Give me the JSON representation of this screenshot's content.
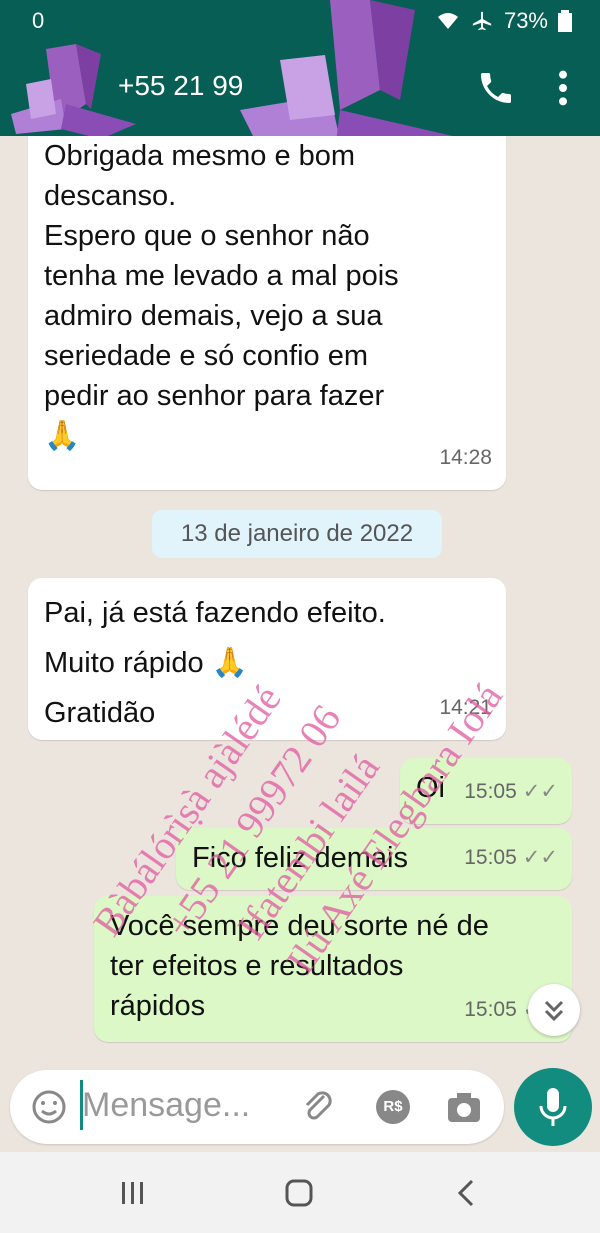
{
  "status_bar": {
    "time": "0",
    "battery": "73%"
  },
  "header": {
    "contact": "+55 21 99"
  },
  "messages": [
    {
      "text": "Obrigada mesmo e bom\ndescanso.\nEspero que o senhor não\ntenha me levado a mal pois\nadmiro demais, vejo a sua\nseriedade e só confio em\npedir ao senhor para fazer\n🙏",
      "time": "14:28"
    },
    {
      "text": "Pai, já está fazendo efeito.\nMuito rápido 🙏\nGratidão",
      "time": "14:21"
    },
    {
      "text": "Oi",
      "time": "15:05"
    },
    {
      "text": "Fico feliz demais",
      "time": "15:05"
    },
    {
      "text": "Você sempre deu sorte né de\nter efeitos e resultados\nrápidos",
      "time": "15:05"
    }
  ],
  "date_divider": "13 de janeiro de 2022",
  "watermark": {
    "line1": "Bàbálórìṣà ajàlédé",
    "line2": "+55 21 99972 06",
    "line3": "Ifatembi lailá",
    "line4": "Ilú Axé Elegbara Iolá"
  },
  "input": {
    "placeholder": "Mensage..."
  },
  "colors": {
    "header": "#075E54",
    "outgoing_bubble": "#DCF8C6",
    "accent": "#128C7E",
    "watermark": "#E05AA0"
  },
  "icons": [
    "call-icon",
    "more-icon",
    "emoji-icon",
    "attach-icon",
    "payment-icon",
    "camera-icon",
    "mic-icon",
    "chevron-down-icon",
    "recents-icon",
    "home-icon",
    "back-icon"
  ]
}
